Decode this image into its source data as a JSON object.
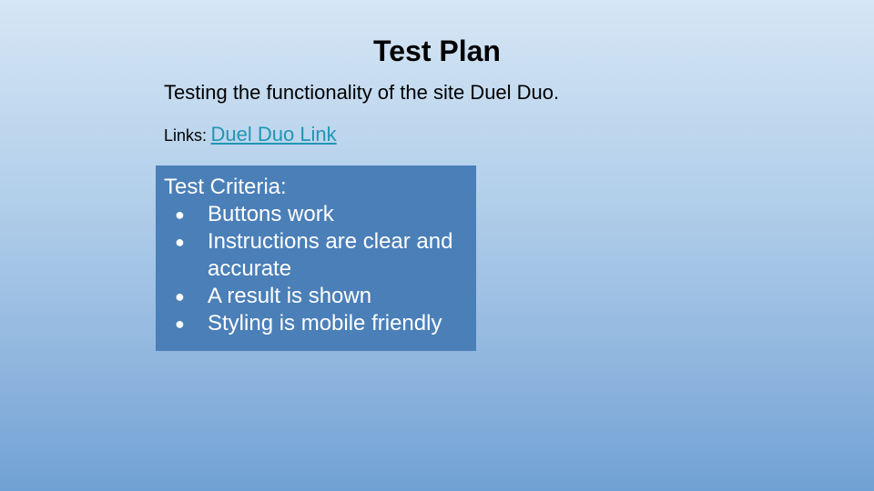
{
  "slide": {
    "title": "Test Plan",
    "subtitle": "Testing the functionality of the site Duel Duo.",
    "links": {
      "label": "Links:",
      "link_text": "Duel Duo Link"
    },
    "criteria": {
      "heading": "Test Criteria:",
      "bullet_glyph": "●",
      "items": [
        "Buttons work",
        "Instructions are clear and accurate",
        "A result is shown",
        "Styling is mobile friendly"
      ]
    }
  },
  "colors": {
    "background_top": "#d6e6f5",
    "background_bottom": "#70a1d4",
    "criteria_box": "#4a7fb8",
    "link": "#2196b3"
  }
}
